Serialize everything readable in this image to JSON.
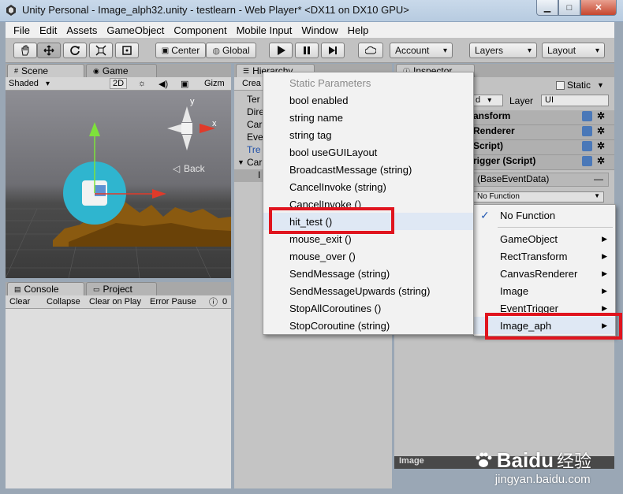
{
  "window": {
    "title": "Unity Personal - Image_alph32.unity - testlearn - Web Player* <DX11 on DX10 GPU>",
    "min": "▁",
    "max": "□",
    "close": "✕"
  },
  "menubar": [
    "File",
    "Edit",
    "Assets",
    "GameObject",
    "Component",
    "Mobile Input",
    "Window",
    "Help"
  ],
  "toolbar": {
    "center_label": "Center",
    "global_label": "Global",
    "account_label": "Account",
    "layers_label": "Layers",
    "layout_label": "Layout"
  },
  "scene_panel": {
    "tabs": [
      "Scene",
      "Game"
    ],
    "shading": "Shaded",
    "mode_2d": "2D",
    "gizmos": "Gizm",
    "back_label": "Back",
    "axis_y": "y",
    "axis_x": "x"
  },
  "console_panel": {
    "tabs": [
      "Console",
      "Project"
    ],
    "buttons": [
      "Clear",
      "Collapse",
      "Clear on Play",
      "Error Pause"
    ],
    "count": "0"
  },
  "hierarchy_panel": {
    "tab": "Hierarchy",
    "create_label": "Crea",
    "rows": [
      "Ter",
      "Dire",
      "Car",
      "Eve",
      "Tre",
      "Car",
      "I"
    ]
  },
  "inspector_panel": {
    "tab": "Inspector",
    "static_label": "Static",
    "layer_label": "Layer",
    "layer_value": "UI",
    "tag_value": "d",
    "components": [
      "ansform",
      "Renderer",
      "Script)",
      "rigger (Script)"
    ],
    "event_label": "(BaseEventData)",
    "function_field": "No Function",
    "footer": "Image"
  },
  "method_menu": {
    "header": "Static Parameters",
    "items": [
      "bool enabled",
      "string name",
      "string tag",
      "bool useGUILayout",
      "BroadcastMessage (string)",
      "CancelInvoke (string)",
      "CancelInvoke ()",
      "hit_test ()",
      "mouse_exit ()",
      "mouse_over ()",
      "SendMessage (string)",
      "SendMessageUpwards (string)",
      "StopAllCoroutines ()",
      "StopCoroutine (string)"
    ]
  },
  "component_menu": {
    "no_function": "No Function",
    "items": [
      "GameObject",
      "RectTransform",
      "CanvasRenderer",
      "Image",
      "EventTrigger",
      "Image_aph"
    ]
  },
  "watermark": {
    "brand": "Baidu",
    "brand_cn": "经验",
    "url": "jingyan.baidu.com"
  },
  "colors": {
    "highlight_box": "#e0141e",
    "accent_blue": "#2b5fb4"
  }
}
